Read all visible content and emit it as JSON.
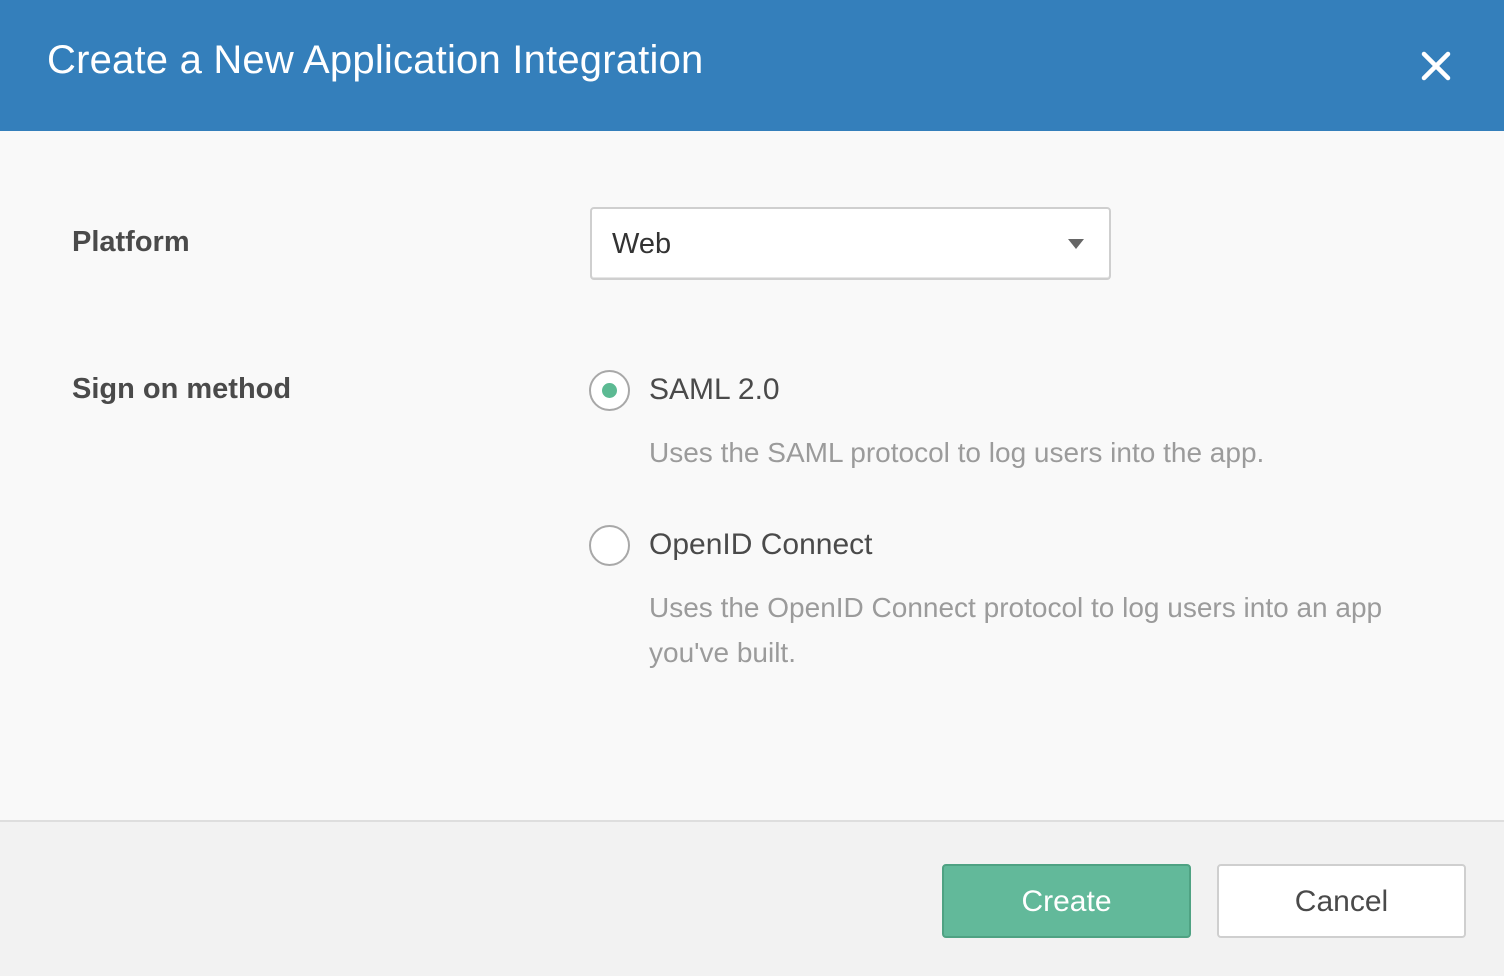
{
  "dialog": {
    "title": "Create a New Application Integration"
  },
  "platform": {
    "label": "Platform",
    "selected": "Web"
  },
  "sign_on": {
    "label": "Sign on method",
    "options": [
      {
        "label": "SAML 2.0",
        "description": "Uses the SAML protocol to log users into the app.",
        "checked": true
      },
      {
        "label": "OpenID Connect",
        "description": "Uses the OpenID Connect protocol to log users into an app you've built.",
        "checked": false
      }
    ]
  },
  "footer": {
    "create_label": "Create",
    "cancel_label": "Cancel"
  },
  "colors": {
    "header": "#347fbb",
    "accent": "#62b99a",
    "radio_dot": "#5cba93"
  },
  "icons": {
    "close": "close-icon",
    "dropdown": "caret-down-icon"
  }
}
